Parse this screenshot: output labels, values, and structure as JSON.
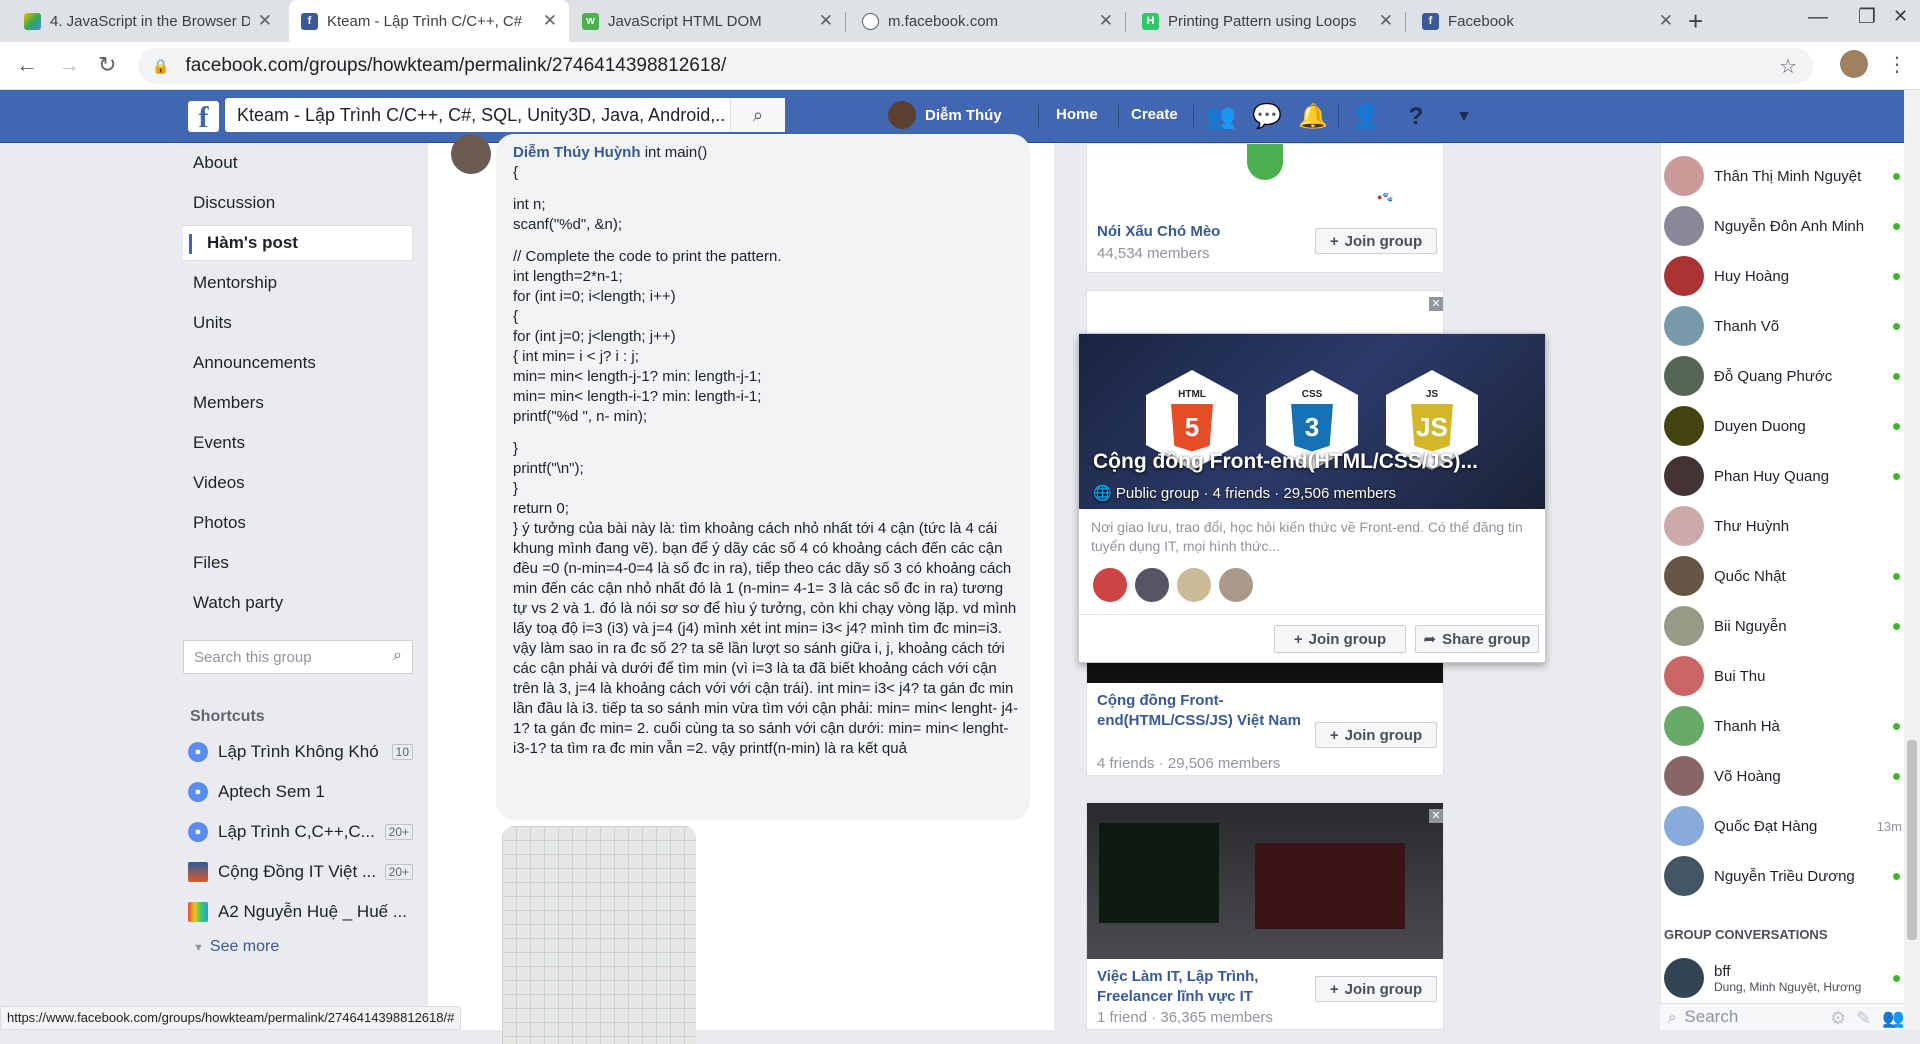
{
  "browser": {
    "tabs": [
      {
        "title": "4. JavaScript in the Browser D",
        "favicon": "drive"
      },
      {
        "title": "Kteam - Lập Trình C/C++, C#",
        "favicon": "facebook"
      },
      {
        "title": "JavaScript HTML DOM",
        "favicon": "w3schools"
      },
      {
        "title": "m.facebook.com",
        "favicon": "globe"
      },
      {
        "title": "Printing Pattern using Loops",
        "favicon": "hackerrank"
      },
      {
        "title": "Facebook",
        "favicon": "facebook"
      }
    ],
    "url": "facebook.com/groups/howkteam/permalink/2746414398812618/",
    "status_url": "https://www.facebook.com/groups/howkteam/permalink/2746414398812618/#"
  },
  "fb_header": {
    "search_value": "Kteam - Lập Trình C/C++, C#, SQL, Unity3D, Java, Android,...",
    "user_name": "Diễm Thúy",
    "home": "Home",
    "create": "Create",
    "brand_color": "#4267b2"
  },
  "left_nav": {
    "items": [
      "About",
      "Discussion",
      "Hàm's post",
      "Mentorship",
      "Units",
      "Announcements",
      "Members",
      "Events",
      "Videos",
      "Photos",
      "Files",
      "Watch party"
    ],
    "selected": "Hàm's post",
    "search_placeholder": "Search this group",
    "shortcuts_title": "Shortcuts",
    "shortcuts": [
      {
        "name": "Lập Trình Không Khó",
        "badge": "10"
      },
      {
        "name": "Aptech Sem 1",
        "badge": ""
      },
      {
        "name": "Lập Trình C,C++,C...",
        "badge": "20+"
      },
      {
        "name": "Cộng Đồng IT Việt ...",
        "badge": "20+"
      },
      {
        "name": "A2 Nguyễn Huệ _ Huế ...",
        "badge": ""
      }
    ],
    "see_more": "See more"
  },
  "post": {
    "author": "Diễm Thúy Huỳnh",
    "lines": [
      "int main()",
      "{",
      "",
      "int n;",
      "scanf(\"%d\", &n);",
      "",
      "// Complete the code to print the pattern.",
      "int length=2*n-1;",
      "for (int i=0; i<length; i++)",
      "{",
      "for (int j=0; j<length; j++)",
      "{ int min= i < j? i : j;",
      "min= min< length-j-1? min: length-j-1;",
      "min= min< length-i-1? min: length-i-1;",
      "printf(\"%d \", n- min);",
      "",
      "}",
      "printf(\"\\n\");",
      "}",
      "return 0;"
    ],
    "explanation": "} ý tưởng của bài này là: tìm khoảng cách nhỏ nhất tới 4 cận (tức là 4 cái khung mình đang vẽ). bạn để ý dãy các số 4 có khoảng cách đến các cận đều =0 (n-min=4-0=4 là số đc in ra), tiếp theo các dãy số 3 có khoảng cách min đến các cận nhỏ nhất đó là 1 (n-min= 4-1= 3 là các số đc in ra) tương tự vs 2 và 1. đó là nói sơ sơ để hìu ý tưởng, còn khi chạy vòng lặp. vd mình lấy toạ độ i=3 (i3) và j=4 (j4) mình xét int min= i3< j4? mình tìm đc min=i3. vậy làm sao in ra đc số 2? ta sẽ lần lượt so sánh giữa i, j, khoảng cách tới các cận phải và dưới để tìm min (vì i=3 là ta đã biết khoảng cách với cận trên là 3, j=4 là khoảng cách với với cận trái). int min= i3< j4? ta gán đc min lần đầu là i3. tiếp ta so sánh min vừa tìm với cận phải: min= min< lenght- j4-1? ta gán đc min= 2. cuối cùng ta so sánh với cận dưới: min= min< lenght- i3-1? ta tìm ra đc min vẫn =2. vậy printf(n-min) là ra kết quả"
  },
  "suggestions": {
    "join_label": "Join group",
    "groups": [
      {
        "name": "Nói Xấu Chó Mèo",
        "meta": "44,534 members"
      },
      {
        "name": "Cộng đồng Front-end(HTML/CSS/JS) Việt Nam",
        "meta": "4 friends · 29,506 members"
      },
      {
        "name": "Việc Làm IT, Lập Trình, Freelancer lĩnh vực IT",
        "meta": "1 friend · 36,365 members"
      }
    ]
  },
  "hover_card": {
    "title": "Cộng đồng Front-end(HTML/CSS/JS)...",
    "meta": "Public group · 4 friends · 29,506 members",
    "description": "Nơi giao lưu, trao đổi, học hỏi kiến thức về Front-end. Có thể đăng tin tuyển dụng IT, mọi hình thức...",
    "join": "Join group",
    "share": "Share group",
    "badges": [
      "HTML",
      "CSS",
      "JS"
    ]
  },
  "chat": {
    "contacts": [
      {
        "name": "Thân Thị Minh Nguyệt",
        "online": true,
        "color": "#c99"
      },
      {
        "name": "Nguyễn Đôn Anh Minh",
        "online": true,
        "color": "#889"
      },
      {
        "name": "Huy Hoàng",
        "online": true,
        "color": "#a33"
      },
      {
        "name": "Thanh Võ",
        "online": true,
        "color": "#79a"
      },
      {
        "name": "Đỗ Quang Phước",
        "online": true,
        "color": "#565"
      },
      {
        "name": "Duyen Duong",
        "online": true,
        "color": "#441"
      },
      {
        "name": "Phan Huy Quang",
        "online": true,
        "color": "#433"
      },
      {
        "name": "Thư Huỳnh",
        "online": false,
        "color": "#caa"
      },
      {
        "name": "Quốc Nhật",
        "online": true,
        "color": "#654"
      },
      {
        "name": "Bii Nguyễn",
        "online": true,
        "color": "#998"
      },
      {
        "name": "Bui Thu",
        "online": false,
        "color": "#c66"
      },
      {
        "name": "Thanh Hà",
        "online": true,
        "color": "#6a6"
      },
      {
        "name": "Võ Hoàng",
        "online": true,
        "color": "#866"
      },
      {
        "name": "Quốc Đạt Hàng",
        "online": false,
        "time": "13m",
        "color": "#8ad"
      },
      {
        "name": "Nguyễn Triều Dương",
        "online": true,
        "color": "#456"
      }
    ],
    "group_conv_title": "GROUP CONVERSATIONS",
    "group": {
      "name": "bff",
      "members": "Dung, Minh Nguyệt, Hương"
    },
    "search_placeholder": "Search"
  }
}
